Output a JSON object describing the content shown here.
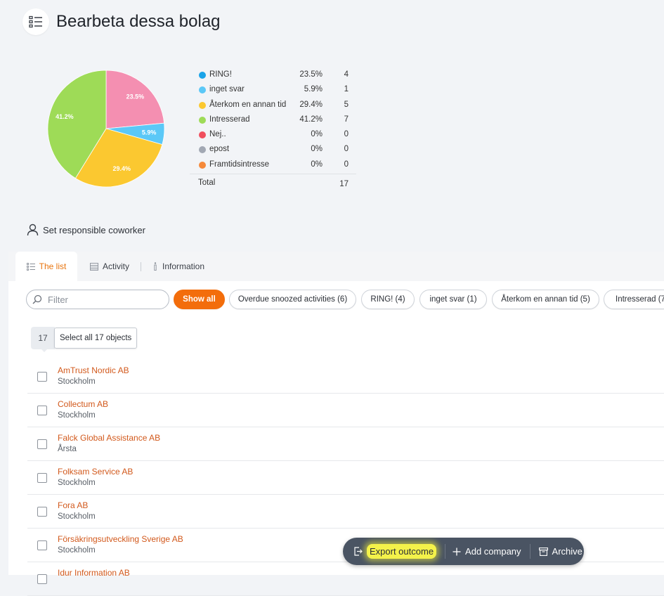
{
  "header": {
    "title": "Bearbeta dessa bolag",
    "icon": "list-icon"
  },
  "chart_data": {
    "type": "pie",
    "slices": [
      {
        "name": "RING!",
        "percent": 23.5,
        "count": 4,
        "color": "#f48fb1"
      },
      {
        "name": "inget svar",
        "percent": 5.9,
        "count": 1,
        "color": "#5bc8f7"
      },
      {
        "name": "Återkom en annan tid",
        "percent": 29.4,
        "count": 5,
        "color": "#fbc830"
      },
      {
        "name": "Intresserad",
        "percent": 41.2,
        "count": 7,
        "color": "#9edb57"
      },
      {
        "name": "Nej..",
        "percent": 0,
        "count": 0,
        "color": "#f04f5e"
      },
      {
        "name": "epost",
        "percent": 0,
        "count": 0,
        "color": "#a2a8b3"
      },
      {
        "name": "Framtidsintresse",
        "percent": 0,
        "count": 0,
        "color": "#f5893a"
      }
    ],
    "labels": [
      "23.5%",
      "5.9%",
      "29.4%",
      "41.2%"
    ],
    "total_label": "Total",
    "total": 17
  },
  "legend": {
    "items": [
      {
        "name": "RING!",
        "pct": "23.5%",
        "count": "4",
        "color": "#1aa3e8"
      },
      {
        "name": "inget svar",
        "pct": "5.9%",
        "count": "1",
        "color": "#5bc8f7"
      },
      {
        "name": "Återkom en annan tid",
        "pct": "29.4%",
        "count": "5",
        "color": "#fbc830"
      },
      {
        "name": "Intresserad",
        "pct": "41.2%",
        "count": "7",
        "color": "#9edb57"
      },
      {
        "name": "Nej..",
        "pct": "0%",
        "count": "0",
        "color": "#f04f5e"
      },
      {
        "name": "epost",
        "pct": "0%",
        "count": "0",
        "color": "#a2a8b3"
      },
      {
        "name": "Framtidsintresse",
        "pct": "0%",
        "count": "0",
        "color": "#f5893a"
      }
    ],
    "total_label": "Total",
    "total_count": "17"
  },
  "responsible": {
    "label": "Set responsible coworker",
    "icon": "user-icon"
  },
  "tabs": [
    {
      "label": "The list",
      "icon": "list-icon",
      "active": true
    },
    {
      "label": "Activity",
      "icon": "activity-icon",
      "active": false
    },
    {
      "label": "Information",
      "icon": "info-icon",
      "active": false
    }
  ],
  "filter": {
    "placeholder": "Filter",
    "value": ""
  },
  "pills": [
    {
      "label": "Show all",
      "active": true
    },
    {
      "label": "Overdue snoozed activities (6)",
      "active": false
    },
    {
      "label": "RING! (4)",
      "active": false
    },
    {
      "label": "inget svar (1)",
      "active": false
    },
    {
      "label": "Återkom en annan tid (5)",
      "active": false
    },
    {
      "label": "Intresserad (7",
      "active": false
    }
  ],
  "selection": {
    "count": "17",
    "select_all_label": "Select all 17 objects"
  },
  "companies": [
    {
      "name": "AmTrust Nordic AB",
      "city": "Stockholm"
    },
    {
      "name": "Collectum AB",
      "city": "Stockholm"
    },
    {
      "name": "Falck Global Assistance AB",
      "city": "Årsta"
    },
    {
      "name": "Folksam Service AB",
      "city": "Stockholm"
    },
    {
      "name": "Fora AB",
      "city": "Stockholm"
    },
    {
      "name": "Försäkringsutveckling Sverige AB",
      "city": "Stockholm"
    },
    {
      "name": "Idur Information AB",
      "city": ""
    }
  ],
  "actions": {
    "export_label": "Export outcome",
    "add_label": "Add company",
    "archive_label": "Archive"
  },
  "colors": {
    "accent": "#f36d0b",
    "link": "#d2591c",
    "action_bar": "#4a5463",
    "highlight": "#f4f24a"
  }
}
